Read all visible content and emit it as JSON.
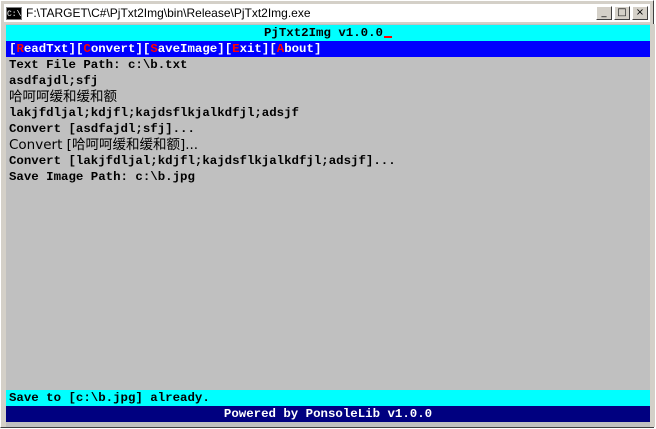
{
  "window": {
    "title": "F:\\TARGET\\C#\\PjTxt2Img\\bin\\Release\\PjTxt2Img.exe",
    "icon_label": "C:\\",
    "buttons": {
      "minimize": "_",
      "maximize": "□",
      "close": "×"
    }
  },
  "console": {
    "app_title": "PjTxt2Img v1.0.0",
    "menu": [
      {
        "open": "[",
        "hotkey": "R",
        "rest": "eadTxt",
        "close": "]"
      },
      {
        "open": "[",
        "hotkey": "C",
        "rest": "onvert",
        "close": "]"
      },
      {
        "open": "[",
        "hotkey": "S",
        "rest": "aveImage",
        "close": "]"
      },
      {
        "open": "[",
        "hotkey": "E",
        "rest": "xit",
        "close": "]"
      },
      {
        "open": "[",
        "hotkey": "A",
        "rest": "bout",
        "close": "]"
      }
    ],
    "lines": [
      "Text File Path: c:\\b.txt",
      "asdfajdl;sfj",
      "哈呵呵缓和缓和额",
      "lakjfdljal;kdjfl;kajdsflkjalkdfjl;adsjf",
      "Convert [asdfajdl;sfj]...",
      "Convert [哈呵呵缓和缓和额]...",
      "Convert [lakjfdljal;kdjfl;kajdsflkjalkdfjl;adsjf]...",
      "Save Image Path: c:\\b.jpg"
    ],
    "status": "Save to [c:\\b.jpg] already.",
    "footer": "Powered by PonsoleLib v1.0.0"
  },
  "colors": {
    "title_bar_bg": "#00ffff",
    "menu_bg": "#0000ff",
    "menu_text": "#ffffff",
    "menu_hotkey": "#ff0000",
    "console_bg": "#c0c0c0",
    "status_bg": "#00ffff",
    "footer_bg": "#000080",
    "footer_text": "#ffffff"
  }
}
